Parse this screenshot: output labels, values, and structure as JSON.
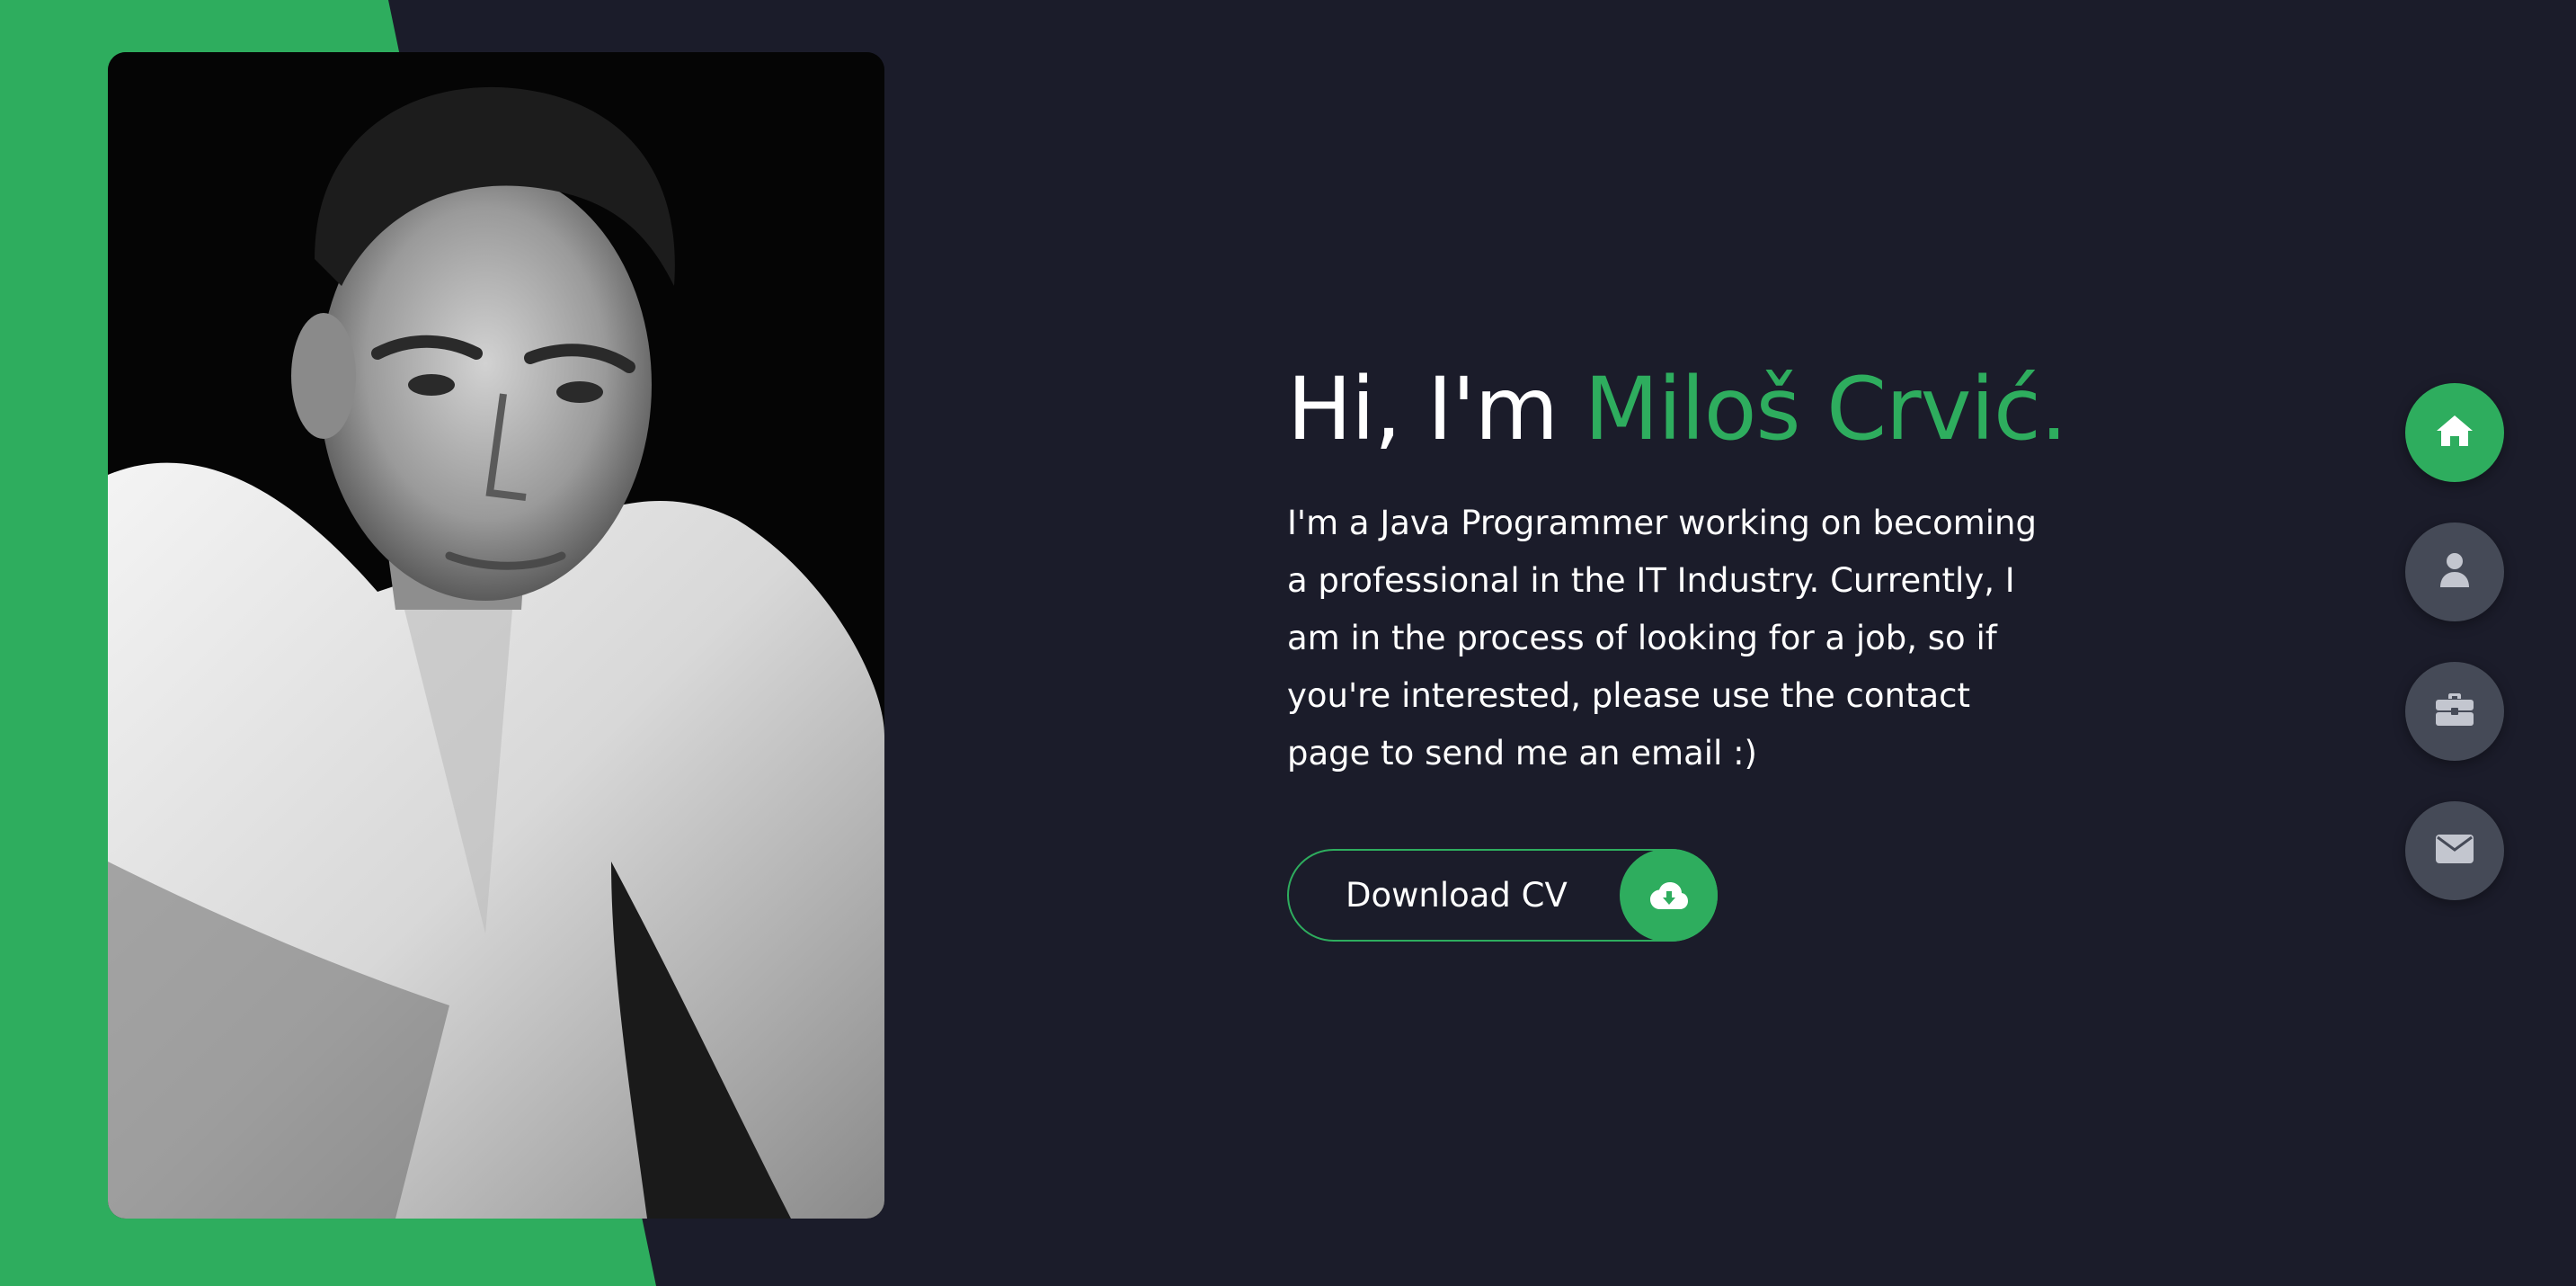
{
  "hero": {
    "greeting": "Hi, I'm ",
    "name": "Miloš Crvić.",
    "bio": "I'm a Java Programmer working on becoming a professional in the IT Industry. Currently, I am in the process of looking for a job, so if you're interested, please use the contact page to send me an email :)",
    "cv_button_label": "Download CV",
    "cv_button_icon": "cloud-download-icon"
  },
  "nav": {
    "items": [
      {
        "icon": "home-icon",
        "active": true
      },
      {
        "icon": "user-icon",
        "active": false
      },
      {
        "icon": "briefcase-icon",
        "active": false
      },
      {
        "icon": "envelope-icon",
        "active": false
      }
    ]
  },
  "colors": {
    "background": "#1b1c2a",
    "accent": "#2ead5e",
    "nav_inactive": "#454a57",
    "text": "#ffffff"
  }
}
